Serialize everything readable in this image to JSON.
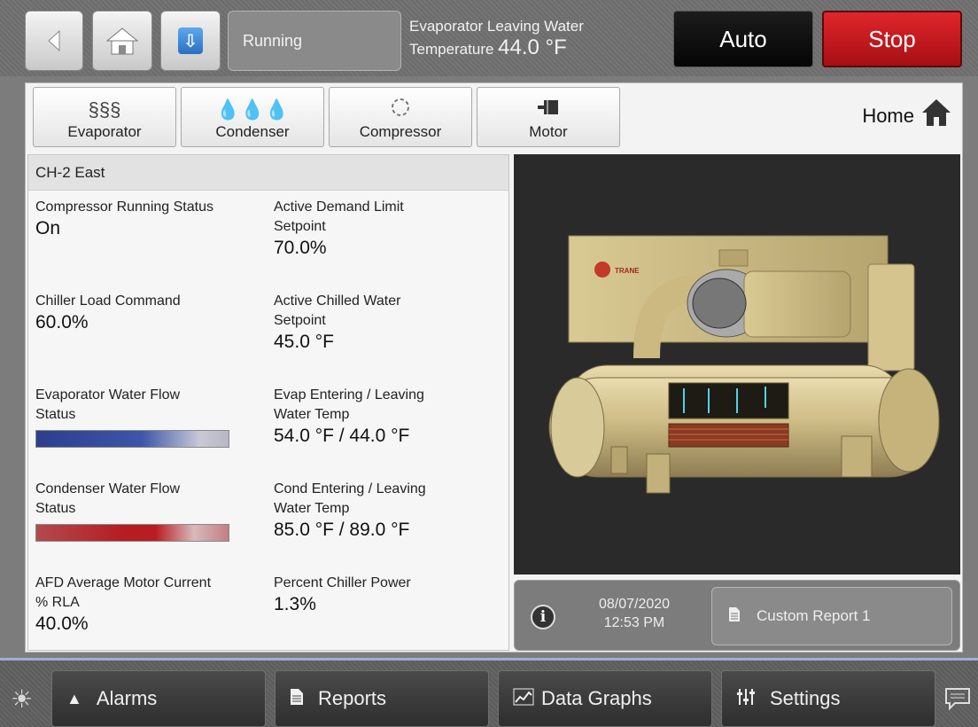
{
  "topbar": {
    "status_text": "Running",
    "evap_label_line1": "Evaporator Leaving Water",
    "evap_label_line2": "Temperature",
    "evap_value": "44.0 °F",
    "auto_label": "Auto",
    "stop_label": "Stop"
  },
  "tabs": [
    {
      "label": "Evaporator",
      "icon": "evaporator-icon"
    },
    {
      "label": "Condenser",
      "icon": "condenser-icon"
    },
    {
      "label": "Compressor",
      "icon": "compressor-icon"
    },
    {
      "label": "Motor",
      "icon": "motor-icon"
    }
  ],
  "home": {
    "label": "Home"
  },
  "unit_name": "CH-2 East",
  "status": {
    "compressor_running": {
      "line1": "Compressor Running Status",
      "value": "On"
    },
    "demand_limit": {
      "line1": "Active Demand Limit",
      "line2": "Setpoint",
      "value": "70.0%"
    },
    "load_command": {
      "line1": "Chiller Load Command",
      "value": "60.0%"
    },
    "chilled_water": {
      "line1": "Active Chilled Water",
      "line2": "Setpoint",
      "value": "45.0 °F"
    },
    "evap_flow": {
      "line1": "Evaporator Water Flow",
      "line2": "Status"
    },
    "evap_temps": {
      "line1": "Evap Entering / Leaving",
      "line2": "Water Temp",
      "value": "54.0 °F / 44.0 °F"
    },
    "cond_flow": {
      "line1": "Condenser Water Flow",
      "line2": "Status"
    },
    "cond_temps": {
      "line1": "Cond Entering / Leaving",
      "line2": "Water Temp",
      "value": "85.0 °F / 89.0 °F"
    },
    "motor_current": {
      "line1": "AFD Average Motor Current",
      "line2": "% RLA",
      "value": "40.0%"
    },
    "chiller_power": {
      "line1": "Percent Chiller Power",
      "value": "1.3%"
    }
  },
  "brand_logo_text": "TRANE",
  "info": {
    "date": "08/07/2020",
    "time": "12:53 PM",
    "report_label": "Custom Report 1"
  },
  "bottom_nav": [
    {
      "label": "Alarms",
      "icon": "bell-icon"
    },
    {
      "label": "Reports",
      "icon": "document-icon"
    },
    {
      "label": "Data Graphs",
      "icon": "graph-icon"
    },
    {
      "label": "Settings",
      "icon": "sliders-icon"
    }
  ],
  "colors": {
    "stop": "#c41a1f",
    "auto": "#0f0f0f",
    "evap_flow": "#3d56a8",
    "cond_flow": "#b51d22"
  }
}
